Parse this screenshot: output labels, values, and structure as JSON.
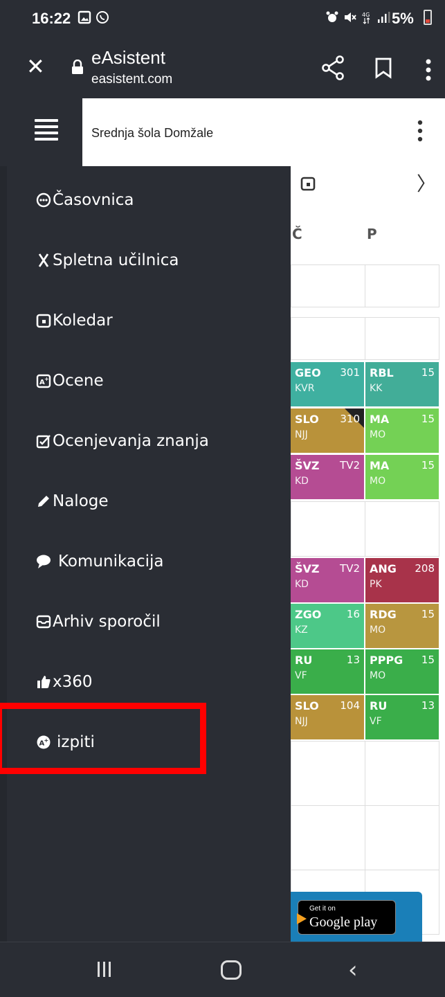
{
  "status_bar": {
    "time": "16:22",
    "battery": "5%"
  },
  "browser": {
    "title": "eAsistent",
    "url": "easistent.com",
    "icons": [
      "close-icon",
      "lock-icon",
      "share-icon",
      "bookmark-icon",
      "more-vert-icon"
    ]
  },
  "header": {
    "school": "Srednja šola Domžale"
  },
  "menu": {
    "items": [
      {
        "label": "Časovnica",
        "icon": "clock-dots-icon"
      },
      {
        "label": "Spletna učilnica",
        "icon": "x-icon"
      },
      {
        "label": "Koledar",
        "icon": "calendar-icon"
      },
      {
        "label": "Ocene",
        "icon": "grades-icon"
      },
      {
        "label": "Ocenjevanja znanja",
        "icon": "checkbox-edit-icon"
      },
      {
        "label": "Naloge",
        "icon": "pencil-icon"
      },
      {
        "label": "Komunikacija",
        "icon": "chat-bubble-icon"
      },
      {
        "label": "Arhiv sporočil",
        "icon": "envelope-icon"
      },
      {
        "label": "x360",
        "icon": "thumbs-icon"
      },
      {
        "label": "izpiti",
        "icon": "exam-icon"
      }
    ]
  },
  "timetable": {
    "days": [
      "Č",
      "P"
    ],
    "lessons": [
      {
        "subject": "GEO",
        "room": "301",
        "teacher": "KVR",
        "color": "#3fb0a0"
      },
      {
        "subject": "RBL",
        "room": "15",
        "teacher": "KK",
        "color": "#42ad98"
      },
      {
        "subject": "SLO",
        "room": "310",
        "teacher": "NJJ",
        "color": "#b9923a"
      },
      {
        "subject": "MA",
        "room": "15",
        "teacher": "MO",
        "color": "#74d155"
      },
      {
        "subject": "ŠVZ",
        "room": "TV2",
        "teacher": "KD",
        "color": "#b54c93"
      },
      {
        "subject": "MA",
        "room": "15",
        "teacher": "MO",
        "color": "#74d155"
      },
      {
        "subject": "ŠVZ",
        "room": "TV2",
        "teacher": "KD",
        "color": "#b54c93"
      },
      {
        "subject": "ANG",
        "room": "208",
        "teacher": "PK",
        "color": "#a8334a"
      },
      {
        "subject": "ZGO",
        "room": "16",
        "teacher": "KZ",
        "color": "#4dc888"
      },
      {
        "subject": "RDG",
        "room": "15",
        "teacher": "MO",
        "color": "#b8963f"
      },
      {
        "subject": "RU",
        "room": "13",
        "teacher": "VF",
        "color": "#3aae4a"
      },
      {
        "subject": "PPPG",
        "room": "15",
        "teacher": "MO",
        "color": "#3aae4a"
      },
      {
        "subject": "SLO",
        "room": "104",
        "teacher": "NJJ",
        "color": "#b9923a"
      },
      {
        "subject": "RU",
        "room": "13",
        "teacher": "VF",
        "color": "#3aae4a"
      }
    ]
  },
  "play_badge": {
    "get_it_on": "Get it on",
    "store": "Google play"
  }
}
